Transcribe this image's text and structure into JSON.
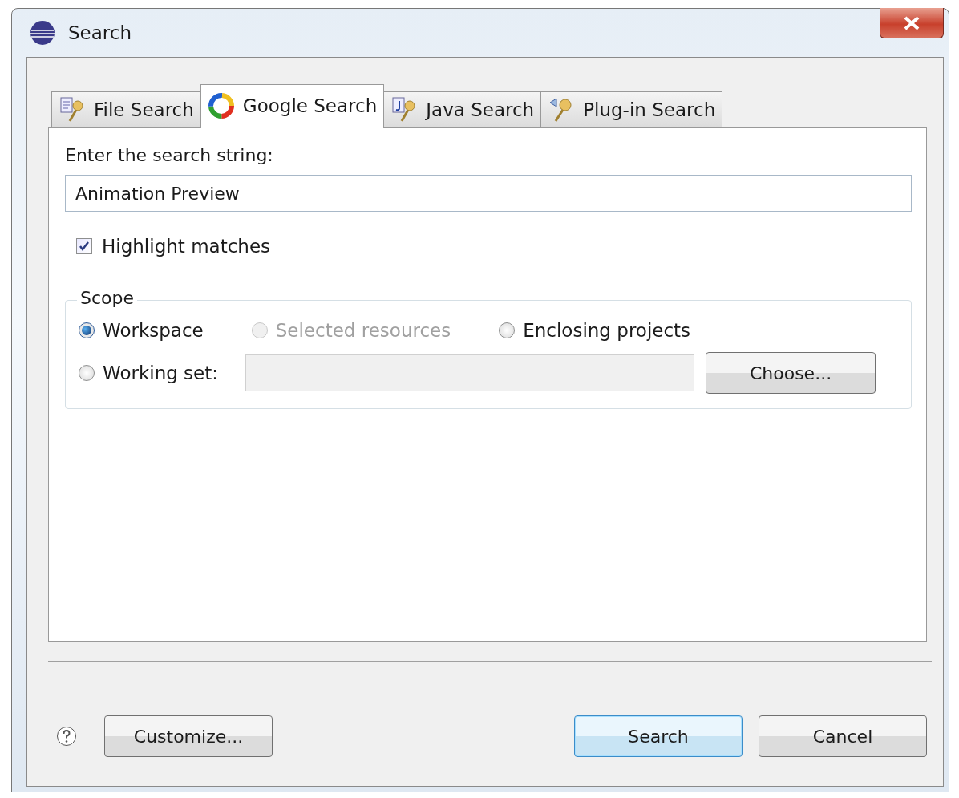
{
  "window": {
    "title": "Search"
  },
  "tabs": [
    {
      "label": "File Search",
      "kind": "file",
      "selected": false
    },
    {
      "label": "Google Search",
      "kind": "google",
      "selected": true
    },
    {
      "label": "Java Search",
      "kind": "java",
      "selected": false
    },
    {
      "label": "Plug-in Search",
      "kind": "plugin",
      "selected": false
    }
  ],
  "search_label": "Enter the search string:",
  "search_field": {
    "value": "Animation Preview"
  },
  "highlight_matches": {
    "label": "Highlight matches",
    "checked": true
  },
  "scope": {
    "title": "Scope",
    "options": [
      {
        "label": "Workspace",
        "selected": true,
        "disabled": false
      },
      {
        "label": "Selected resources",
        "selected": false,
        "disabled": true
      },
      {
        "label": "Enclosing projects",
        "selected": false,
        "disabled": false
      },
      {
        "label": "Working set:",
        "selected": false,
        "disabled": false
      }
    ],
    "choose_button": "Choose..."
  },
  "footer": {
    "customize_button": "Customize...",
    "buttons": [
      {
        "label": "Search",
        "default": true
      },
      {
        "label": "Cancel",
        "default": false
      }
    ]
  }
}
